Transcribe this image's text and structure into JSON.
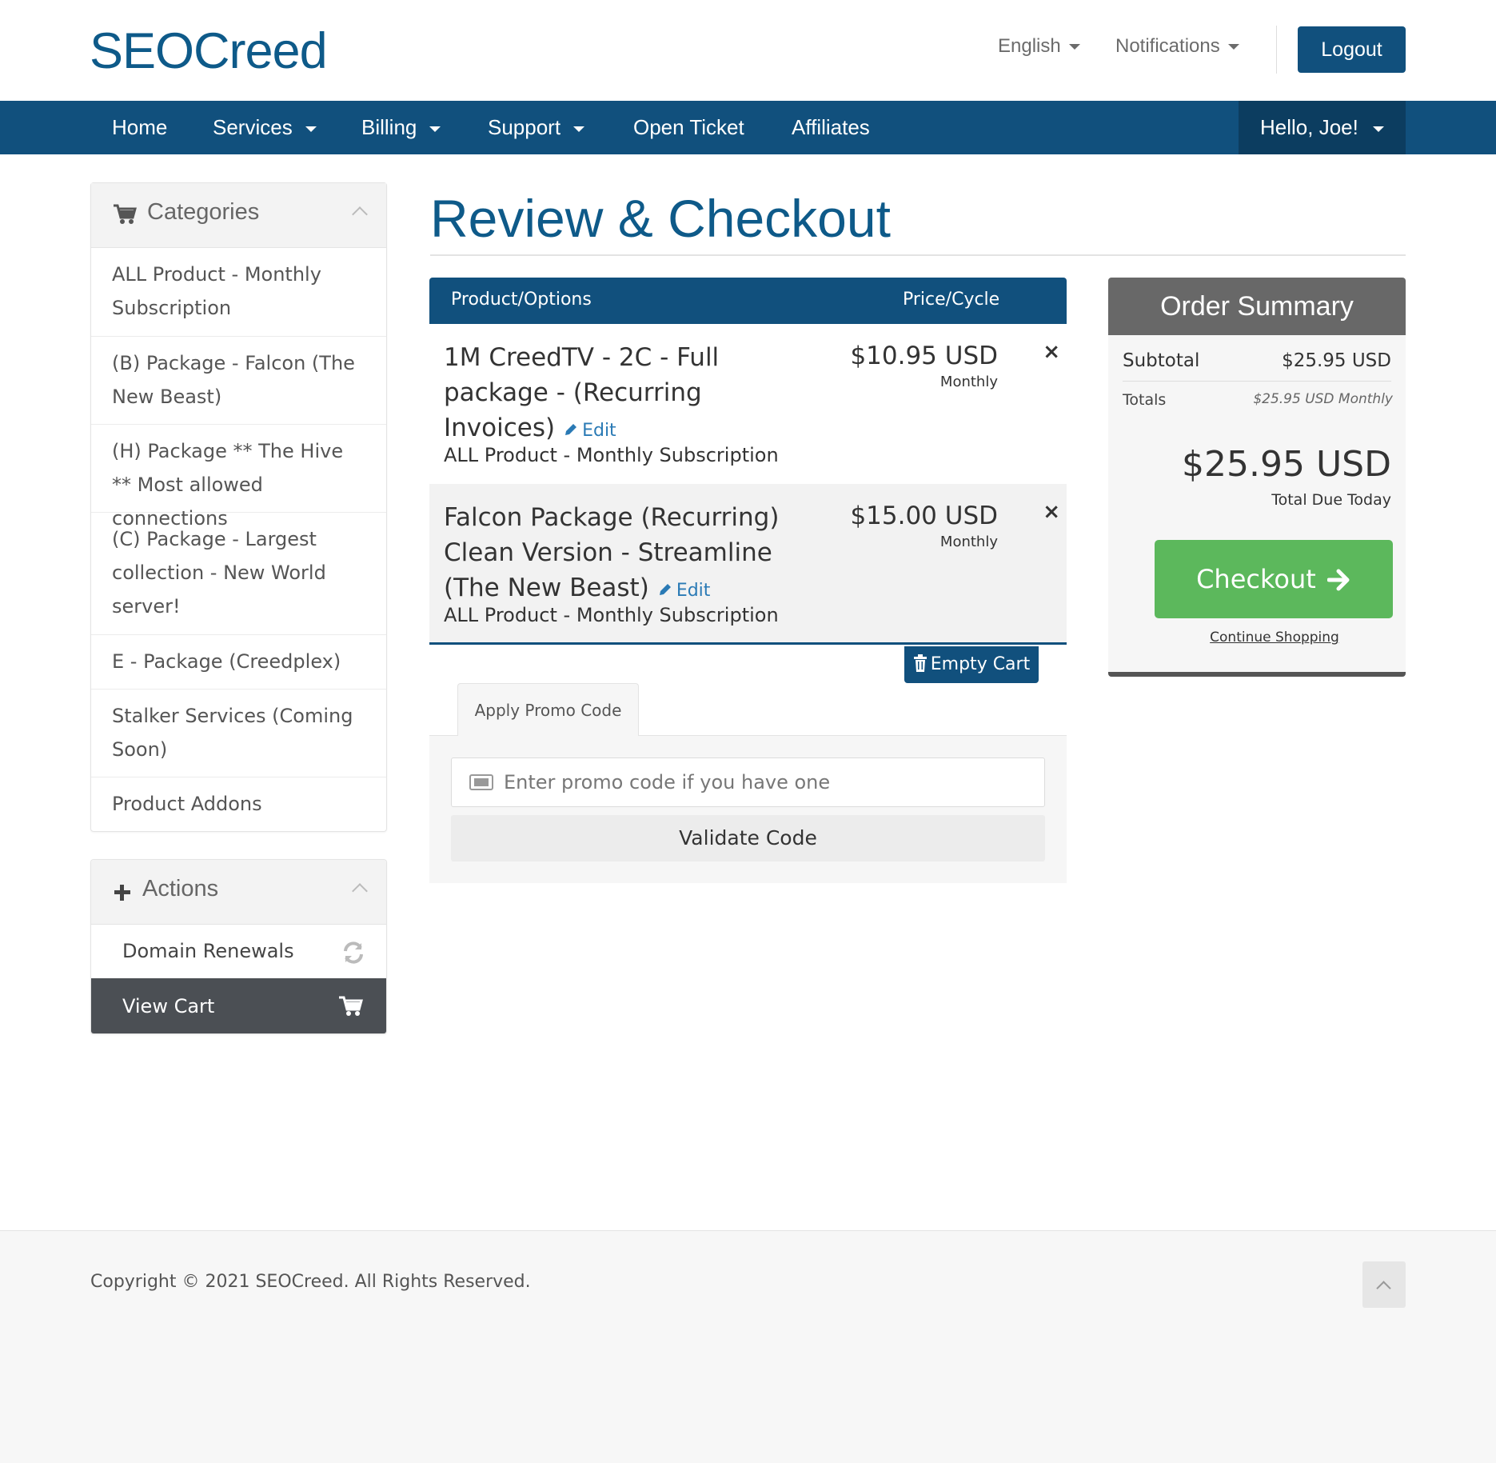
{
  "brand": {
    "logo": "SEOCreed",
    "accent": "#11507d",
    "success": "#5cb85c"
  },
  "topbar": {
    "language": "English",
    "notifications": "Notifications",
    "logout": "Logout"
  },
  "nav": {
    "items": [
      "Home",
      "Services",
      "Billing",
      "Support",
      "Open Ticket",
      "Affiliates"
    ],
    "user": "Hello, Joe!"
  },
  "sidebar": {
    "categories_title": "Categories",
    "categories": [
      "ALL Product - Monthly Subscription",
      "(B) Package - Falcon (The New Beast)",
      "(H) Package ** The Hive ** Most allowed connections",
      "(C) Package - Largest collection - New World server!",
      "E - Package (Creedplex)",
      "Stalker Services (Coming Soon)",
      "Product Addons"
    ],
    "actions_title": "Actions",
    "actions": [
      "Domain Renewals",
      "View Cart"
    ]
  },
  "page": {
    "title": "Review & Checkout"
  },
  "cart": {
    "col_product": "Product/Options",
    "col_price": "Price/Cycle",
    "edit_label": "Edit",
    "items": [
      {
        "name": "1M CreedTV - 2C - Full package - (Recurring Invoices)",
        "group": "ALL Product - Monthly Subscription",
        "price": "$10.95 USD",
        "cycle": "Monthly",
        "remove": "×"
      },
      {
        "name": "Falcon Package (Recurring) Clean Version - Streamline (The New Beast)",
        "group": "ALL Product - Monthly Subscription",
        "price": "$15.00 USD",
        "cycle": "Monthly",
        "remove": "×"
      }
    ],
    "empty_cart": "Empty Cart"
  },
  "promo": {
    "tab": "Apply Promo Code",
    "placeholder": "Enter promo code if you have one",
    "validate": "Validate Code"
  },
  "summary": {
    "title": "Order Summary",
    "subtotal_label": "Subtotal",
    "subtotal_value": "$25.95 USD",
    "totals_label": "Totals",
    "totals_value": "$25.95 USD Monthly",
    "total_due": "$25.95 USD",
    "total_due_label": "Total Due Today",
    "checkout": "Checkout",
    "continue": "Continue Shopping"
  },
  "footer": {
    "copyright": "Copyright © 2021 SEOCreed. All Rights Reserved."
  }
}
